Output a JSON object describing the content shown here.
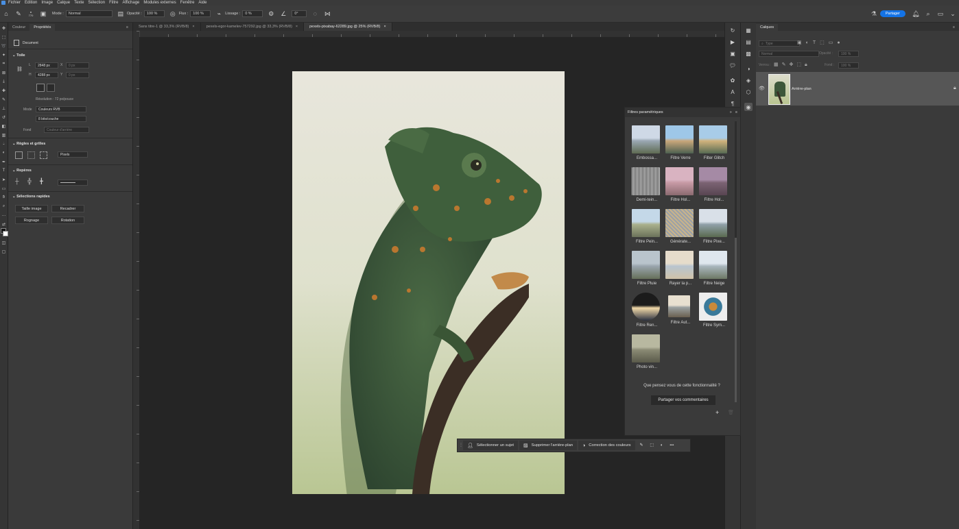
{
  "menu": [
    "Fichier",
    "Edition",
    "Image",
    "Calque",
    "Texte",
    "Sélection",
    "Filtre",
    "Affichage",
    "Modules externes",
    "Fenêtre",
    "Aide"
  ],
  "options": {
    "brush_size": "770",
    "mode_label": "Mode :",
    "mode_value": "Normal",
    "opacity_label": "Opacité :",
    "opacity_value": "100 %",
    "flow_label": "Flux :",
    "flow_value": "100 %",
    "smoothing_label": "Lissage :",
    "smoothing_value": "0 %",
    "angle_value": "0°",
    "share": "Partager"
  },
  "props": {
    "tabs": [
      "Couleur",
      "Propriétés"
    ],
    "document_label": "Document",
    "canvas_title": "Toile",
    "w_label": "L",
    "w_value": "2848 px",
    "x_label": "X",
    "x_value": "0 px",
    "h_label": "H",
    "h_value": "4288 px",
    "y_label": "Y",
    "y_value": "0 px",
    "resolution": "Résolution : 72 px/pouce",
    "mode_label": "Mode",
    "mode_value": "Couleurs RVB",
    "bits_value": "8 bits/couche",
    "fond_label": "Fond",
    "fond_value": "Couleur d'arrière",
    "rulers_title": "Règles et grilles",
    "unit_value": "Pixels",
    "guides_title": "Repères",
    "quick_title": "Sélections rapides",
    "btn_image_size": "Taille image",
    "btn_crop": "Recadrer",
    "btn_trim": "Rognage",
    "btn_rotate": "Rotation"
  },
  "doc_tabs": [
    "Sans titre-1 @ 33,3% (RVB/8)",
    "pexels-egor-kamelev-757292.jpg @ 33,3% (RVB/8)",
    "pexels-pixabay-62289.jpg @ 25% (RVB/8)"
  ],
  "layers": {
    "title": "Calques",
    "search_placeholder": "Type",
    "blend": "Normal",
    "opacity_label": "Opacité :",
    "opacity_value": "100 %",
    "lock_label": "Verrou :",
    "fill_label": "Fond :",
    "fill_value": "100 %",
    "layer_name": "Arrière-plan"
  },
  "filters": {
    "title": "Filtres paramétriques",
    "items": [
      {
        "label": "Embossa..."
      },
      {
        "label": "Filtre Verre"
      },
      {
        "label": "Filter Glitch"
      },
      {
        "label": "Demi-tein..."
      },
      {
        "label": "Filtre Hol..."
      },
      {
        "label": "Filtre Hol..."
      },
      {
        "label": "Filtre Pein..."
      },
      {
        "label": "Générate..."
      },
      {
        "label": "Filtre Pixe..."
      },
      {
        "label": "Filtre Pluie"
      },
      {
        "label": "Rayer la p..."
      },
      {
        "label": "Filtre Neige"
      },
      {
        "label": "Filtre Ren..."
      },
      {
        "label": "Filtre Aut..."
      },
      {
        "label": "Filtre Sym..."
      },
      {
        "label": "Photo vin..."
      }
    ],
    "feedback_q": "Que pensez vous de cette fonctionnalité ?",
    "feedback_btn": "Partager vos commentaires"
  },
  "taskbar": {
    "select_subject": "Sélectionner un sujet",
    "remove_bg": "Supprimer l'arrière-plan",
    "color_correct": "Correction des couleurs"
  },
  "colors": {
    "accent": "#1473e6",
    "panel": "#3a3a3a",
    "canvas": "#252525"
  }
}
